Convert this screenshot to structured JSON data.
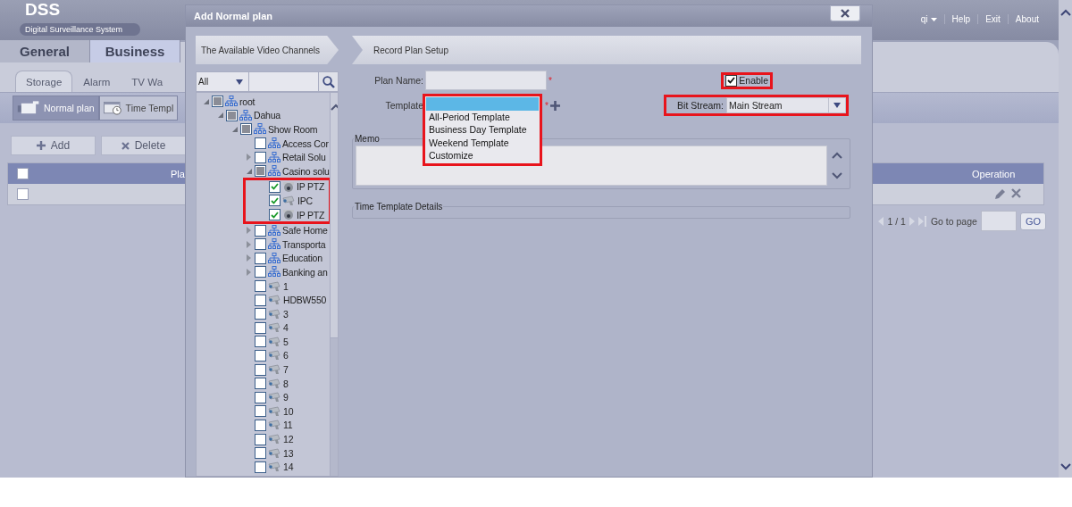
{
  "app": {
    "logo": "DSS",
    "subtitle": "Digital Surveillance System",
    "user_menu": "qi",
    "header_links": [
      "Help",
      "Exit",
      "About"
    ]
  },
  "main_tabs": [
    {
      "label": "General",
      "selected": false
    },
    {
      "label": "Business",
      "selected": true
    }
  ],
  "sub_tabs": [
    {
      "label": "Storage",
      "selected": true
    },
    {
      "label": "Alarm",
      "selected": false
    },
    {
      "label": "TV Wa",
      "selected": false
    }
  ],
  "plan_tabs": [
    {
      "label": "Normal plan",
      "selected": true,
      "kind": "camera"
    },
    {
      "label": "Time Templ",
      "selected": false,
      "kind": "calendar"
    }
  ],
  "toolbar": [
    {
      "label": "Add",
      "kind": "add"
    },
    {
      "label": "Delete",
      "kind": "delete"
    }
  ],
  "table": {
    "header_checked": false,
    "columns": [
      "Pla",
      "Operation"
    ],
    "rows": [
      {
        "checked": false
      }
    ]
  },
  "pagination": {
    "page": "1 / 1",
    "goto_label": "Go to page",
    "go": "GO"
  },
  "dialog": {
    "title": "Add Normal plan",
    "steps": [
      "The Available Video Channels",
      "Record Plan Setup"
    ],
    "channel_filter": {
      "value": "All"
    },
    "tree": [
      {
        "label": "root",
        "kind": "group",
        "checked": false,
        "partial": true,
        "expanded": true,
        "children": [
          {
            "label": "Dahua",
            "kind": "group",
            "checked": false,
            "partial": true,
            "expanded": true,
            "children": [
              {
                "label": "Show Room",
                "kind": "group",
                "checked": false,
                "partial": true,
                "expanded": true,
                "children": [
                  {
                    "label": "Access Cor",
                    "kind": "group",
                    "checked": false,
                    "partial": false
                  },
                  {
                    "label": "Retail Solu",
                    "kind": "group",
                    "checked": false,
                    "partial": false,
                    "expanded": false
                  },
                  {
                    "label": "Casino solu",
                    "kind": "group",
                    "checked": false,
                    "partial": true,
                    "expanded": true,
                    "annotate_children": true,
                    "children": [
                      {
                        "label": "IP PTZ",
                        "kind": "ptz",
                        "checked": true,
                        "partial": false
                      },
                      {
                        "label": "IPC",
                        "kind": "ipc",
                        "checked": true,
                        "partial": false
                      },
                      {
                        "label": "IP PTZ",
                        "kind": "ptz",
                        "checked": true,
                        "partial": false
                      }
                    ]
                  },
                  {
                    "label": "Safe Home",
                    "kind": "group",
                    "checked": false,
                    "partial": false,
                    "expanded": false
                  },
                  {
                    "label": "Transporta",
                    "kind": "group",
                    "checked": false,
                    "partial": false,
                    "expanded": false
                  },
                  {
                    "label": "Education",
                    "kind": "group",
                    "checked": false,
                    "partial": false,
                    "expanded": false
                  },
                  {
                    "label": "Banking an",
                    "kind": "group",
                    "checked": false,
                    "partial": false,
                    "expanded": false
                  },
                  {
                    "label": "1",
                    "kind": "ipc",
                    "checked": false,
                    "partial": false
                  },
                  {
                    "label": "HDBW550",
                    "kind": "ipc",
                    "checked": false,
                    "partial": false
                  },
                  {
                    "label": "3",
                    "kind": "ipc",
                    "checked": false,
                    "partial": false
                  },
                  {
                    "label": "4",
                    "kind": "ipc",
                    "checked": false,
                    "partial": false
                  },
                  {
                    "label": "5",
                    "kind": "ipc",
                    "checked": false,
                    "partial": false
                  },
                  {
                    "label": "6",
                    "kind": "ipc",
                    "checked": false,
                    "partial": false
                  },
                  {
                    "label": "7",
                    "kind": "ipc",
                    "checked": false,
                    "partial": false
                  },
                  {
                    "label": "8",
                    "kind": "ipc",
                    "checked": false,
                    "partial": false
                  },
                  {
                    "label": "9",
                    "kind": "ipc",
                    "checked": false,
                    "partial": false
                  },
                  {
                    "label": "10",
                    "kind": "ipc",
                    "checked": false,
                    "partial": false
                  },
                  {
                    "label": "11",
                    "kind": "ipc",
                    "checked": false,
                    "partial": false
                  },
                  {
                    "label": "12",
                    "kind": "ipc",
                    "checked": false,
                    "partial": false
                  },
                  {
                    "label": "13",
                    "kind": "ipc",
                    "checked": false,
                    "partial": false
                  },
                  {
                    "label": "14",
                    "kind": "ipc",
                    "checked": false,
                    "partial": false
                  }
                ]
              }
            ]
          }
        ]
      }
    ],
    "plan_name": {
      "label": "Plan Name:",
      "required_mark": "*"
    },
    "enable": {
      "label": "Enable",
      "checked": true,
      "annotated": true
    },
    "template": {
      "label": "Template",
      "required_mark": "*",
      "open": true,
      "annotated": true,
      "options": [
        {
          "selected": true
        },
        {
          "label": "All-Period Template",
          "selected": false
        },
        {
          "label": "Business Day Template",
          "selected": false
        },
        {
          "label": "Weekend Template",
          "selected": false
        },
        {
          "label": "Customize",
          "selected": false
        }
      ]
    },
    "bit_stream": {
      "label": "Bit Stream:",
      "value": "Main Stream",
      "annotated": true
    },
    "memo": {
      "label": "Memo"
    },
    "time_template": {
      "label": "Time Template Details"
    }
  }
}
